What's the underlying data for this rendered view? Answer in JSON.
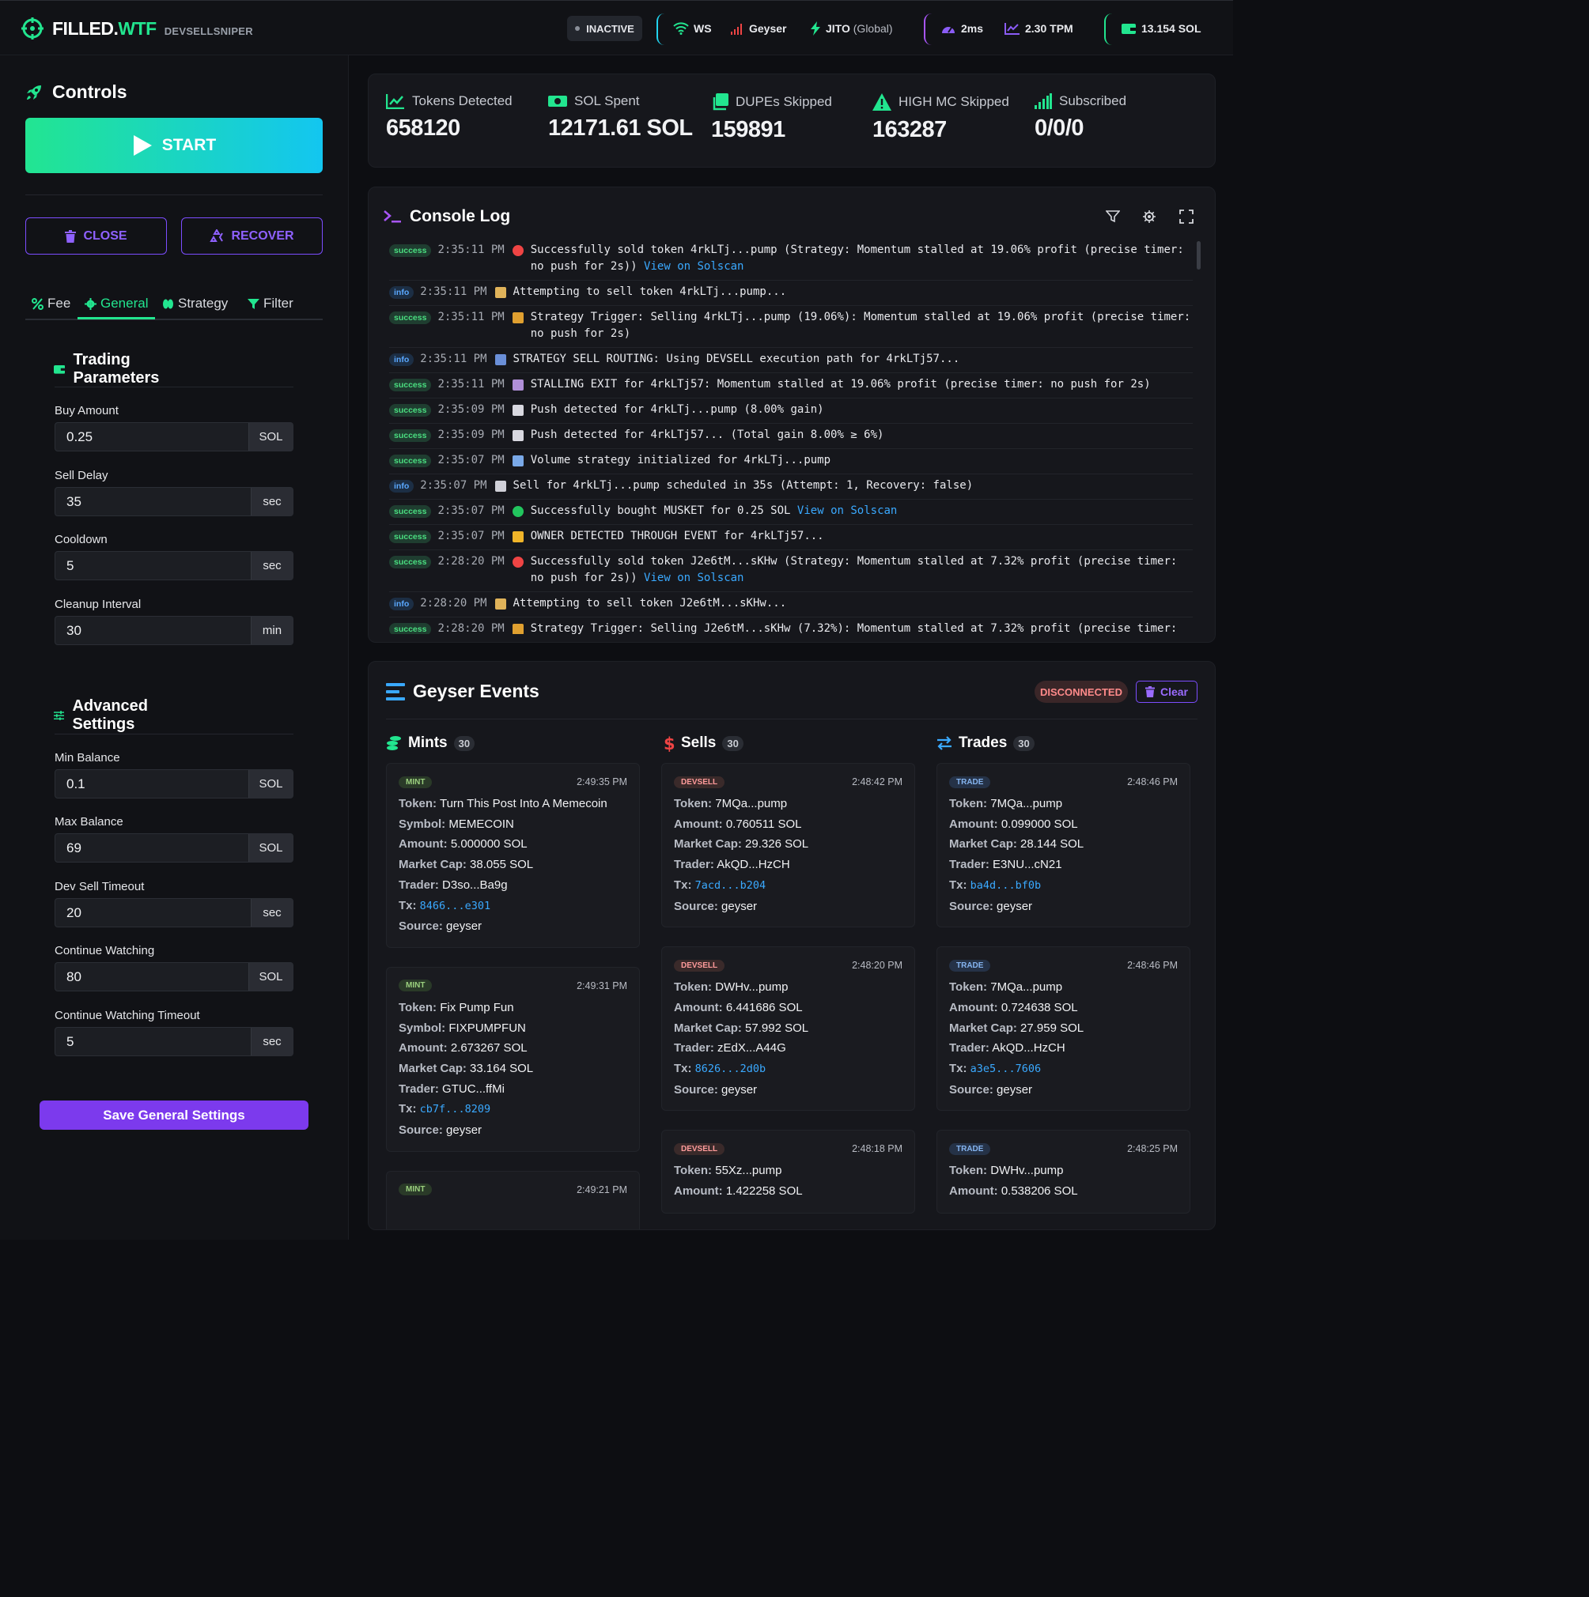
{
  "header": {
    "brand_main": "FILLED.",
    "brand_accent": "WTF",
    "brand_sub": "DEVSELLSNIPER",
    "status": "INACTIVE",
    "ws": "WS",
    "geyser": "Geyser",
    "jito": "JITO",
    "jito_region": "(Global)",
    "latency": "2ms",
    "tpm": "2.30 TPM",
    "balance": "13.154 SOL"
  },
  "sidebar": {
    "title": "Controls",
    "start_label": "START",
    "close_label": "CLOSE",
    "recover_label": "RECOVER",
    "tabs": [
      {
        "label": "Fee",
        "icon": "percent-icon"
      },
      {
        "label": "General",
        "icon": "gear-icon",
        "active": true
      },
      {
        "label": "Strategy",
        "icon": "brain-icon"
      },
      {
        "label": "Filter",
        "icon": "filter-icon"
      }
    ],
    "trading": {
      "title": "Trading Parameters",
      "fields": [
        {
          "label": "Buy Amount",
          "value": "0.25",
          "unit": "SOL"
        },
        {
          "label": "Sell Delay",
          "value": "35",
          "unit": "sec"
        },
        {
          "label": "Cooldown",
          "value": "5",
          "unit": "sec"
        },
        {
          "label": "Cleanup Interval",
          "value": "30",
          "unit": "min"
        }
      ]
    },
    "advanced": {
      "title": "Advanced Settings",
      "fields": [
        {
          "label": "Min Balance",
          "value": "0.1",
          "unit": "SOL"
        },
        {
          "label": "Max Balance",
          "value": "69",
          "unit": "SOL"
        },
        {
          "label": "Dev Sell Timeout",
          "value": "20",
          "unit": "sec"
        },
        {
          "label": "Continue Watching",
          "value": "80",
          "unit": "SOL"
        },
        {
          "label": "Continue Watching Timeout",
          "value": "5",
          "unit": "sec"
        }
      ]
    },
    "save_label": "Save General Settings"
  },
  "stats": [
    {
      "label": "Tokens Detected",
      "value": "658120",
      "icon": "chart-line-icon"
    },
    {
      "label": "SOL Spent",
      "value": "12171.61 SOL",
      "icon": "money-icon"
    },
    {
      "label": "DUPEs Skipped",
      "value": "159891",
      "icon": "copy-icon"
    },
    {
      "label": "HIGH MC Skipped",
      "value": "163287",
      "icon": "warning-icon"
    },
    {
      "label": "Subscribed",
      "value": "0/0/0",
      "icon": "signal-icon"
    }
  ],
  "console": {
    "title": "Console Log",
    "logs": [
      {
        "level": "success",
        "time": "2:35:11 PM",
        "emoji": "red-circle",
        "text": "Successfully sold token 4rkLTj...pump (Strategy: Momentum stalled at 19.06% profit (precise timer: no push for 2s))",
        "link": "View on Solscan"
      },
      {
        "level": "info",
        "time": "2:35:11 PM",
        "emoji": "hourglass",
        "text": "Attempting to sell token 4rkLTj...pump..."
      },
      {
        "level": "success",
        "time": "2:35:11 PM",
        "emoji": "moneybag",
        "text": "Strategy Trigger: Selling 4rkLTj...pump (19.06%): Momentum stalled at 19.06% profit (precise timer: no push for 2s)"
      },
      {
        "level": "info",
        "time": "2:35:11 PM",
        "emoji": "bar-chart",
        "text": "STRATEGY SELL ROUTING: Using DEVSELL execution path for 4rkLTj57..."
      },
      {
        "level": "success",
        "time": "2:35:11 PM",
        "emoji": "snail",
        "text": "STALLING EXIT for 4rkLTj57: Momentum stalled at 19.06% profit (precise timer: no push for 2s)"
      },
      {
        "level": "success",
        "time": "2:35:09 PM",
        "emoji": "rocket",
        "text": "Push detected for 4rkLTj...pump (8.00% gain)"
      },
      {
        "level": "success",
        "time": "2:35:09 PM",
        "emoji": "rocket",
        "text": "Push detected for 4rkLTj57... (Total gain 8.00% ≥ 6%)"
      },
      {
        "level": "success",
        "time": "2:35:07 PM",
        "emoji": "chart-up",
        "text": "Volume strategy initialized for 4rkLTj...pump"
      },
      {
        "level": "info",
        "time": "2:35:07 PM",
        "emoji": "clock",
        "text": "Sell for 4rkLTj...pump scheduled in 35s (Attempt: 1, Recovery: false)"
      },
      {
        "level": "success",
        "time": "2:35:07 PM",
        "emoji": "green-circle",
        "text": "Successfully bought MUSKET for 0.25 SOL",
        "link": "View on Solscan"
      },
      {
        "level": "success",
        "time": "2:35:07 PM",
        "emoji": "crown",
        "text": "OWNER DETECTED THROUGH EVENT for 4rkLTj57..."
      },
      {
        "level": "success",
        "time": "2:28:20 PM",
        "emoji": "red-circle",
        "text": "Successfully sold token J2e6tM...sKHw (Strategy: Momentum stalled at 7.32% profit (precise timer: no push for 2s))",
        "link": "View on Solscan"
      },
      {
        "level": "info",
        "time": "2:28:20 PM",
        "emoji": "hourglass",
        "text": "Attempting to sell token J2e6tM...sKHw..."
      },
      {
        "level": "success",
        "time": "2:28:20 PM",
        "emoji": "moneybag",
        "text": "Strategy Trigger: Selling J2e6tM...sKHw (7.32%): Momentum stalled at 7.32% profit (precise timer:"
      }
    ]
  },
  "geyser": {
    "title": "Geyser Events",
    "status": "DISCONNECTED",
    "clear_label": "Clear",
    "columns": [
      {
        "title": "Mints",
        "count": "30",
        "icon": "coins-icon",
        "events": [
          {
            "tag": "MINT",
            "time": "2:49:35 PM",
            "rows": [
              [
                "Token:",
                "Turn This Post Into A Memecoin"
              ],
              [
                "Symbol:",
                "MEMECOIN"
              ],
              [
                "Amount:",
                "5.000000 SOL"
              ],
              [
                "Market Cap:",
                "38.055 SOL"
              ],
              [
                "Trader:",
                "D3so...Ba9g"
              ],
              [
                "Tx:",
                "8466...e301",
                "tx"
              ],
              [
                "Source:",
                "geyser"
              ]
            ]
          },
          {
            "tag": "MINT",
            "time": "2:49:31 PM",
            "rows": [
              [
                "Token:",
                "Fix Pump Fun"
              ],
              [
                "Symbol:",
                "FIXPUMPFUN"
              ],
              [
                "Amount:",
                "2.673267 SOL"
              ],
              [
                "Market Cap:",
                "33.164 SOL"
              ],
              [
                "Trader:",
                "GTUC...ffMi"
              ],
              [
                "Tx:",
                "cb7f...8209",
                "tx"
              ],
              [
                "Source:",
                "geyser"
              ]
            ]
          },
          {
            "tag": "MINT",
            "time": "2:49:21 PM",
            "rows": []
          }
        ]
      },
      {
        "title": "Sells",
        "count": "30",
        "icon": "dollar-icon",
        "events": [
          {
            "tag": "DEVSELL",
            "time": "2:48:42 PM",
            "rows": [
              [
                "Token:",
                "7MQa...pump"
              ],
              [
                "Amount:",
                "0.760511 SOL"
              ],
              [
                "Market Cap:",
                "29.326 SOL"
              ],
              [
                "Trader:",
                "AkQD...HzCH"
              ],
              [
                "Tx:",
                "7acd...b204",
                "tx"
              ],
              [
                "Source:",
                "geyser"
              ]
            ]
          },
          {
            "tag": "DEVSELL",
            "time": "2:48:20 PM",
            "rows": [
              [
                "Token:",
                "DWHv...pump"
              ],
              [
                "Amount:",
                "6.441686 SOL"
              ],
              [
                "Market Cap:",
                "57.992 SOL"
              ],
              [
                "Trader:",
                "zEdX...A44G"
              ],
              [
                "Tx:",
                "8626...2d0b",
                "tx"
              ],
              [
                "Source:",
                "geyser"
              ]
            ]
          },
          {
            "tag": "DEVSELL",
            "time": "2:48:18 PM",
            "rows": [
              [
                "Token:",
                "55Xz...pump"
              ],
              [
                "Amount:",
                "1.422258 SOL"
              ]
            ]
          }
        ]
      },
      {
        "title": "Trades",
        "count": "30",
        "icon": "swap-icon",
        "events": [
          {
            "tag": "TRADE",
            "time": "2:48:46 PM",
            "rows": [
              [
                "Token:",
                "7MQa...pump"
              ],
              [
                "Amount:",
                "0.099000 SOL"
              ],
              [
                "Market Cap:",
                "28.144 SOL"
              ],
              [
                "Trader:",
                "E3NU...cN21"
              ],
              [
                "Tx:",
                "ba4d...bf0b",
                "tx"
              ],
              [
                "Source:",
                "geyser"
              ]
            ]
          },
          {
            "tag": "TRADE",
            "time": "2:48:46 PM",
            "rows": [
              [
                "Token:",
                "7MQa...pump"
              ],
              [
                "Amount:",
                "0.724638 SOL"
              ],
              [
                "Market Cap:",
                "27.959 SOL"
              ],
              [
                "Trader:",
                "AkQD...HzCH"
              ],
              [
                "Tx:",
                "a3e5...7606",
                "tx"
              ],
              [
                "Source:",
                "geyser"
              ]
            ]
          },
          {
            "tag": "TRADE",
            "time": "2:48:25 PM",
            "rows": [
              [
                "Token:",
                "DWHv...pump"
              ],
              [
                "Amount:",
                "0.538206 SOL"
              ]
            ]
          }
        ]
      }
    ]
  }
}
